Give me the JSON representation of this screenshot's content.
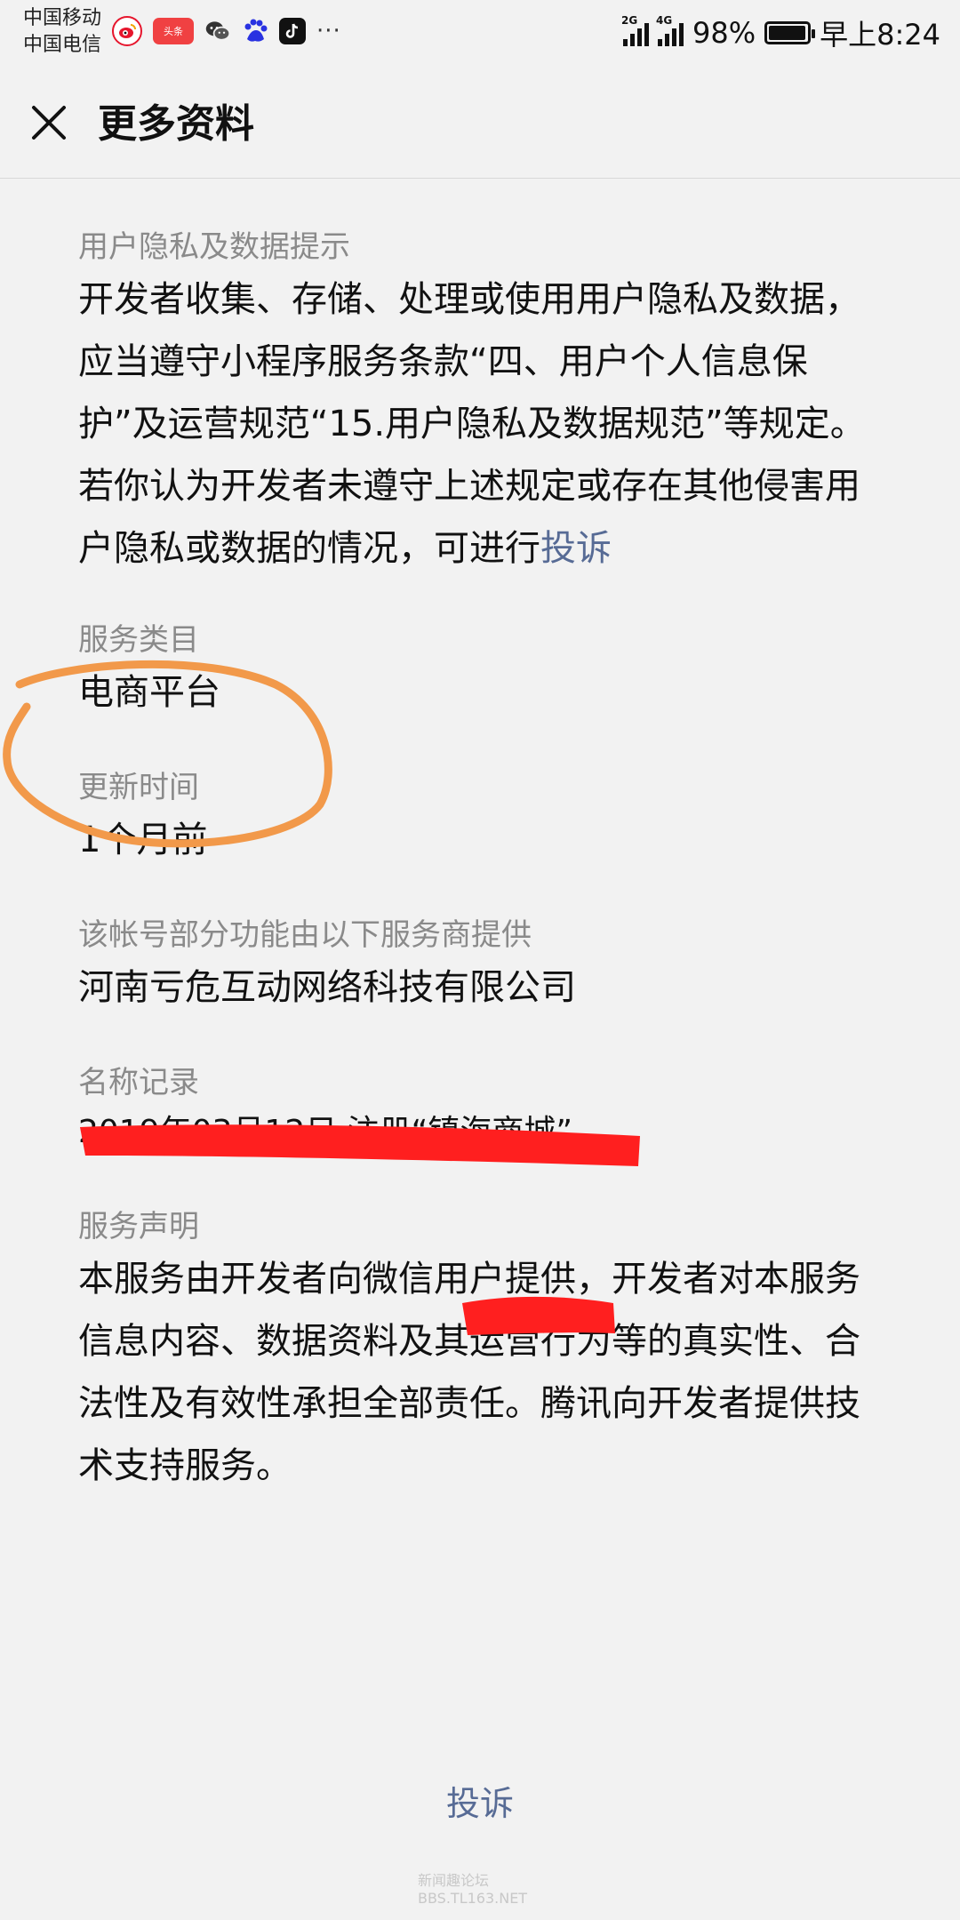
{
  "status_bar": {
    "carrier_1": "中国移动",
    "carrier_2": "中国电信",
    "toutiao_badge": "头条",
    "more_dots": "···",
    "net_1": "2G",
    "net_2": "4G",
    "battery_percent": "98%",
    "battery_level": 0.98,
    "time": "早上8:24",
    "icons": [
      "weibo-icon",
      "toutiao-icon",
      "wechat-icon",
      "baidu-icon",
      "tiktok-icon"
    ]
  },
  "nav": {
    "title": "更多资料",
    "close_icon": "close-icon"
  },
  "sections": {
    "privacy": {
      "label": "用户隐私及数据提示",
      "text": "开发者收集、存储、处理或使用用户隐私及数据，应当遵守小程序服务条款“四、用户个人信息保护”及运营规范“15.用户隐私及数据规范”等规定。若你认为开发者未遵守上述规定或存在其他侵害用户隐私或数据的情况，可进行",
      "link": "投诉"
    },
    "category": {
      "label": "服务类目",
      "value": "电商平台"
    },
    "update": {
      "label": "更新时间",
      "value": "1个月前"
    },
    "provider": {
      "label": "该帐号部分功能由以下服务商提供",
      "value": "河南亏危互动网络科技有限公司"
    },
    "name_record": {
      "label": "名称记录",
      "value": "2019年03月12日 注册“镇海商城”"
    },
    "statement": {
      "label": "服务声明",
      "value": "本服务由开发者向微信用户提供，开发者对本服务信息内容、数据资料及其运营行为等的真实性、合法性及有效性承担全部责任。腾讯向开发者提供技术支持服务。"
    }
  },
  "footer": {
    "complaint": "投诉",
    "watermark_1": "新闻趣论坛",
    "watermark_2": "BBS.TL163.NET"
  },
  "colors": {
    "background": "#f2f2f2",
    "link": "#576b95",
    "label": "#8a8a8a",
    "annotation": "#f2994a",
    "redaction": "#ff1f1f"
  }
}
